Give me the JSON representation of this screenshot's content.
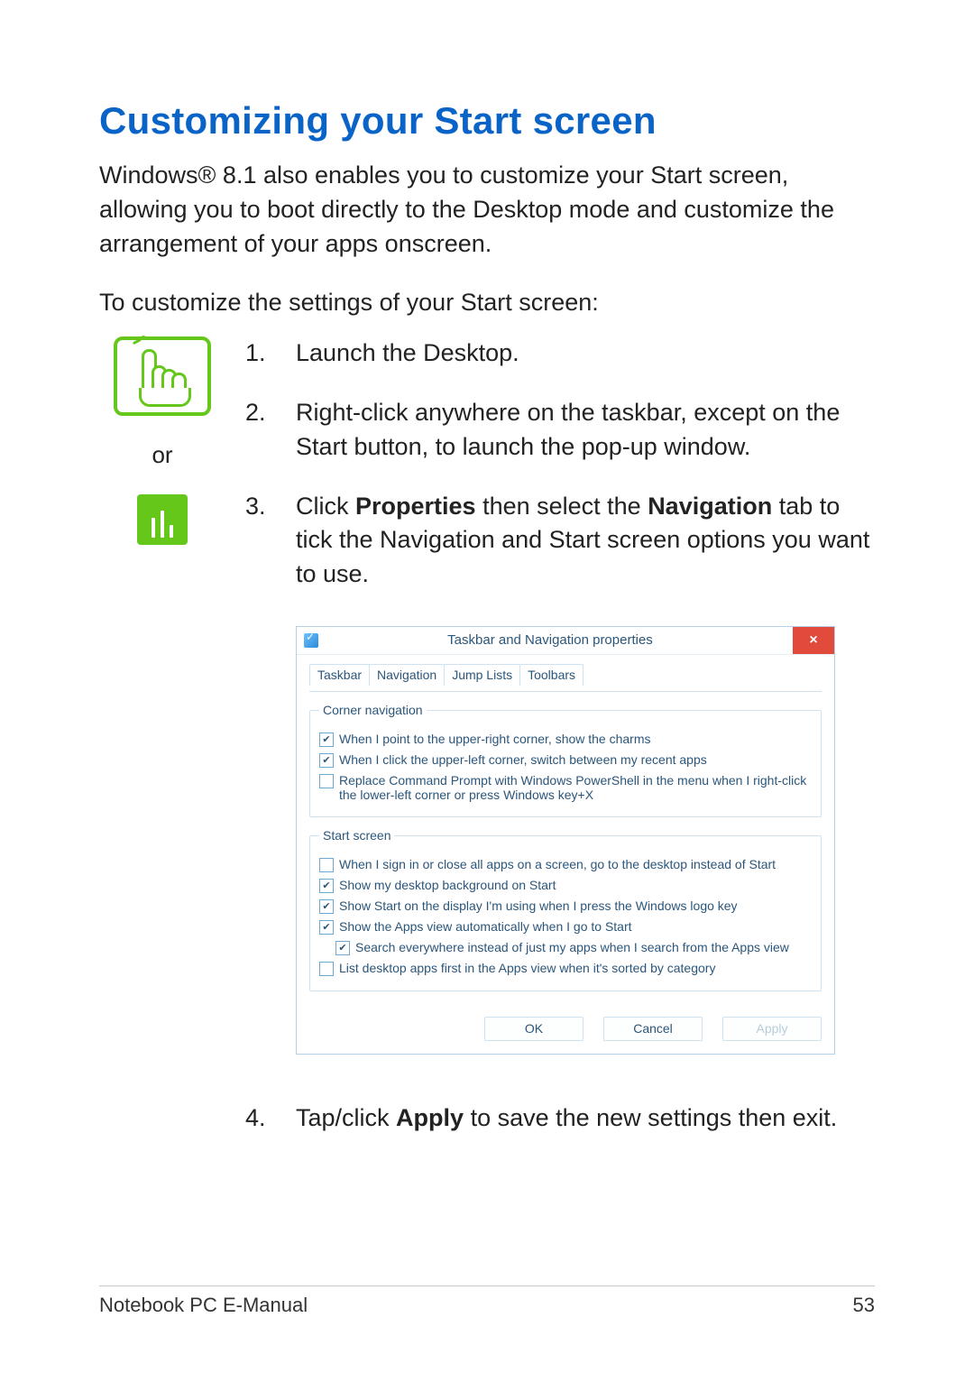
{
  "title": "Customizing your Start screen",
  "intro": "Windows® 8.1 also enables you to customize your Start screen, allowing you to boot directly to the Desktop mode and customize the arrangement of your apps onscreen.",
  "lead": "To customize the settings of your Start screen:",
  "icons": {
    "or": "or"
  },
  "steps": {
    "n1": "1.",
    "s1": "Launch the Desktop.",
    "n2": "2.",
    "s2": "Right-click anywhere on the taskbar, except on the Start button, to launch the pop-up window.",
    "n3": "3.",
    "s3_a": "Click ",
    "s3_b": "Properties",
    "s3_c": " then select the ",
    "s3_d": "Navigation",
    "s3_e": " tab to tick the  Navigation and Start screen options you want to use.",
    "n4": "4.",
    "s4_a": "Tap/click ",
    "s4_b": "Apply",
    "s4_c": " to save the new settings then exit."
  },
  "dialog": {
    "title": "Taskbar and Navigation properties",
    "close": "×",
    "tabs": {
      "taskbar": "Taskbar",
      "navigation": "Navigation",
      "jumplists": "Jump Lists",
      "toolbars": "Toolbars"
    },
    "group1": {
      "legend": "Corner navigation",
      "c1": "When I point to the upper-right corner, show the charms",
      "c2": "When I click the upper-left corner, switch between my recent apps",
      "c3": "Replace Command Prompt with Windows PowerShell in the menu when I right-click the lower-left corner or press Windows key+X"
    },
    "group2": {
      "legend": "Start screen",
      "c1": "When I sign in or close all apps on a screen, go to the desktop instead of Start",
      "c2": "Show my desktop background on Start",
      "c3": "Show Start on the display I'm using when I press the Windows logo key",
      "c4": "Show the Apps view automatically when I go to Start",
      "c5": "Search everywhere instead of just my apps when I search from the Apps view",
      "c6": "List desktop apps first in the Apps view when it's sorted by category"
    },
    "buttons": {
      "ok": "OK",
      "cancel": "Cancel",
      "apply": "Apply"
    }
  },
  "footer": {
    "left": "Notebook PC E-Manual",
    "right": "53"
  }
}
